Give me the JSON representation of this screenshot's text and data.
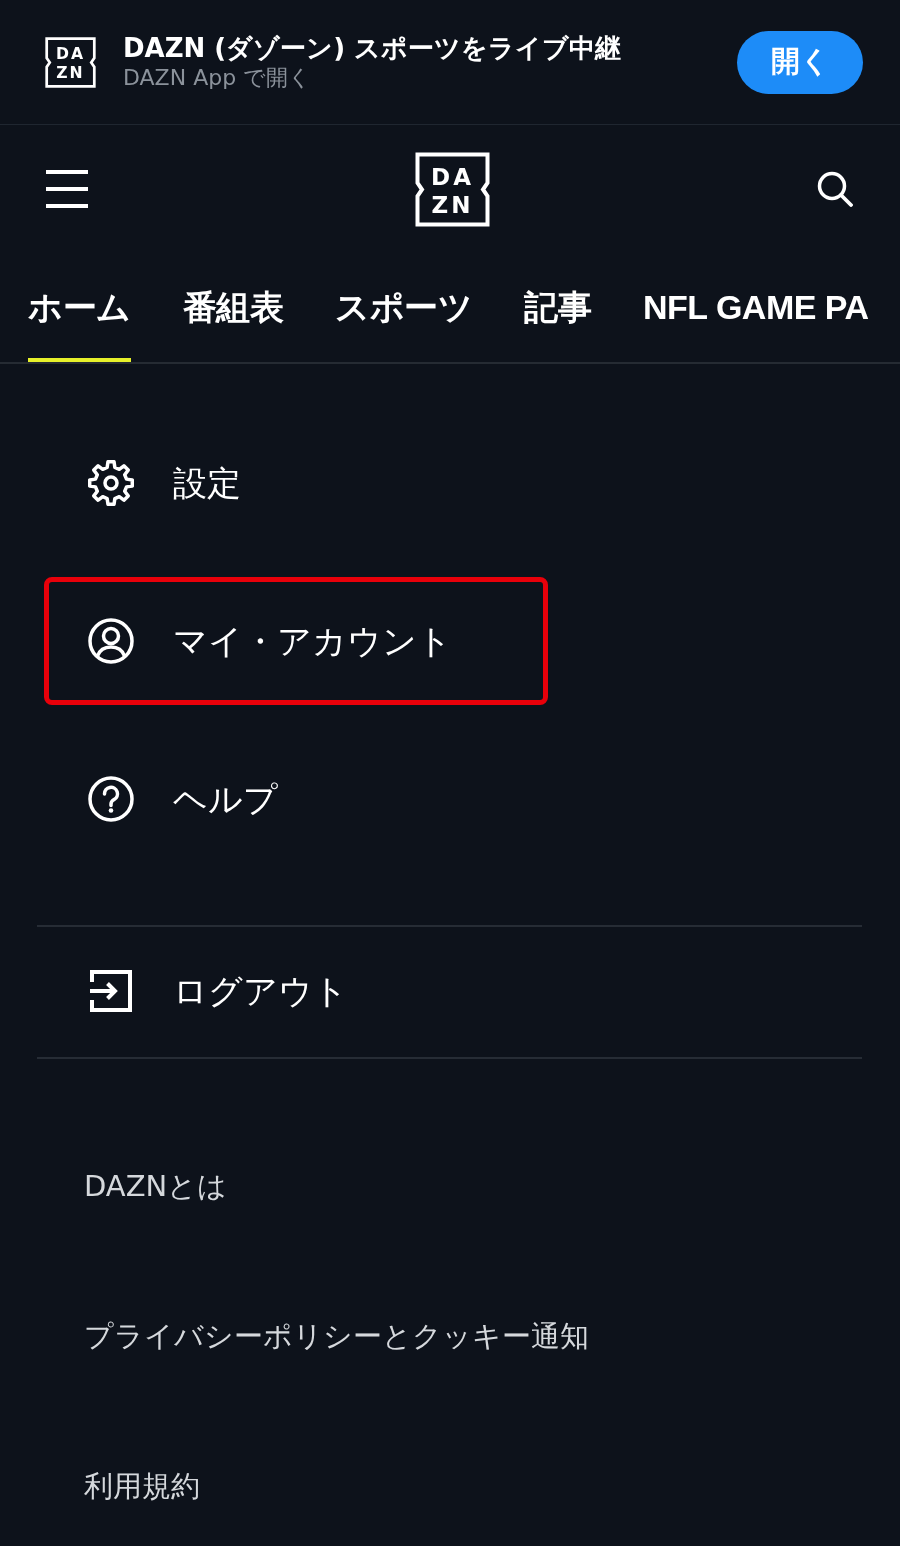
{
  "app_banner": {
    "logo": {
      "line_1": "DA",
      "line_2": "ZN"
    },
    "title": "DAZN (ダゾーン) スポーツをライブ中継",
    "subtitle": "DAZN App で開く",
    "open_button": "開く"
  },
  "header": {
    "logo": {
      "line_1": "DA",
      "line_2": "ZN"
    }
  },
  "tabs": [
    {
      "label": "ホーム",
      "selected": true
    },
    {
      "label": "番組表",
      "selected": false
    },
    {
      "label": "スポーツ",
      "selected": false
    },
    {
      "label": "記事",
      "selected": false
    },
    {
      "label": "NFL GAME PA",
      "selected": false
    }
  ],
  "menu": {
    "items": [
      {
        "kind": "settings",
        "label": "設定",
        "highlighted": false
      },
      {
        "kind": "account",
        "label": "マイ・アカウント",
        "highlighted": true
      },
      {
        "kind": "help",
        "label": "ヘルプ",
        "highlighted": false
      }
    ]
  },
  "session_items": [
    {
      "kind": "logout",
      "label": "ログアウト",
      "highlighted": false
    }
  ],
  "footer_links": [
    "DAZNとは",
    "プライバシーポリシーとクッキー通知",
    "利用規約"
  ]
}
